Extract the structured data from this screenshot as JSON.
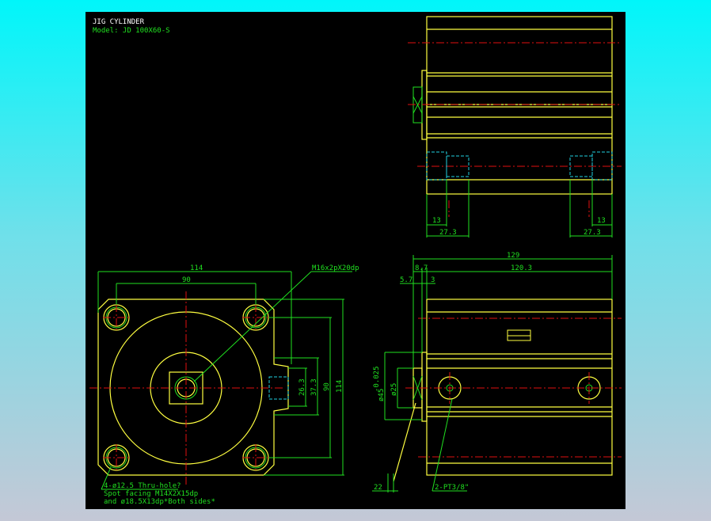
{
  "title": "JIG CYLINDER",
  "model": "Model: JD 100X60-S",
  "colors": {
    "outline": "#ffff40",
    "dimension": "#20e020",
    "centerline": "#e01010",
    "hidden": "#20d0e0",
    "background": "#000000"
  },
  "front_view": {
    "dims": {
      "width_outer": "114",
      "width_holes": "90",
      "height_outer": "114",
      "height_holes": "90",
      "port_37": "37.3",
      "port_26": "26.3"
    },
    "thread_note": "M16x2pX20dp",
    "hole_note": [
      "4-ø12.5 Thru-hole?",
      "Spot facing M14X2X15dp",
      "and ø18.5X13dp*Both sides*"
    ]
  },
  "top_view": {
    "dims": [
      "13",
      "27.3",
      "13",
      "27.3"
    ]
  },
  "side_view": {
    "dims": {
      "total": "129",
      "rod_ext": "8.7",
      "body": "120.3",
      "d1": "5.7",
      "d2": "3",
      "dia_outer": "ø45",
      "dia_outer_tol": "-0.025",
      "dia_rod": "ø25",
      "wrench": "22"
    },
    "port_note": "2-PT3/8\""
  }
}
